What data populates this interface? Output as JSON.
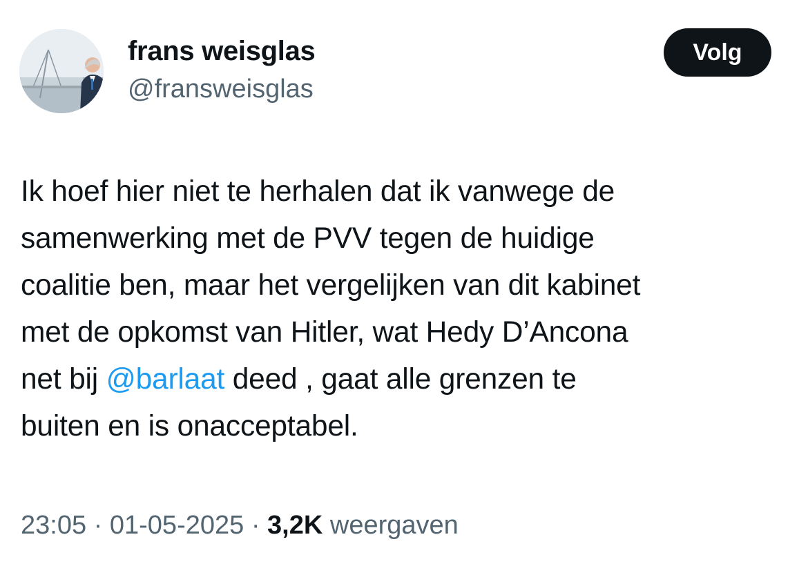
{
  "author": {
    "name": "frans weisglas",
    "handle": "@fransweisglas",
    "avatar_icon": "profile-photo"
  },
  "follow_button": {
    "label": "Volg"
  },
  "tweet": {
    "lines": [
      {
        "text": "Ik hoef hier niet te herhalen dat ik vanwege de"
      },
      {
        "text": "samenwerking met de PVV tegen de huidige"
      },
      {
        "text": "coalitie ben, maar het vergelijken van dit kabinet"
      },
      {
        "text": "met de opkomst van Hitler, wat Hedy D’Ancona"
      },
      {
        "before": "net bij ",
        "mention": "@barlaat",
        "after": " deed , gaat alle grenzen te"
      },
      {
        "text": "buiten en is onacceptabel."
      }
    ]
  },
  "meta": {
    "time": "23:05",
    "separator1": " · ",
    "date": "01-05-2025",
    "separator2": " · ",
    "views_count": "3,2K",
    "views_label": " weergaven"
  },
  "colors": {
    "text": "#0f1419",
    "secondary": "#536471",
    "link": "#1d9bf0",
    "button_bg": "#0f1419"
  }
}
